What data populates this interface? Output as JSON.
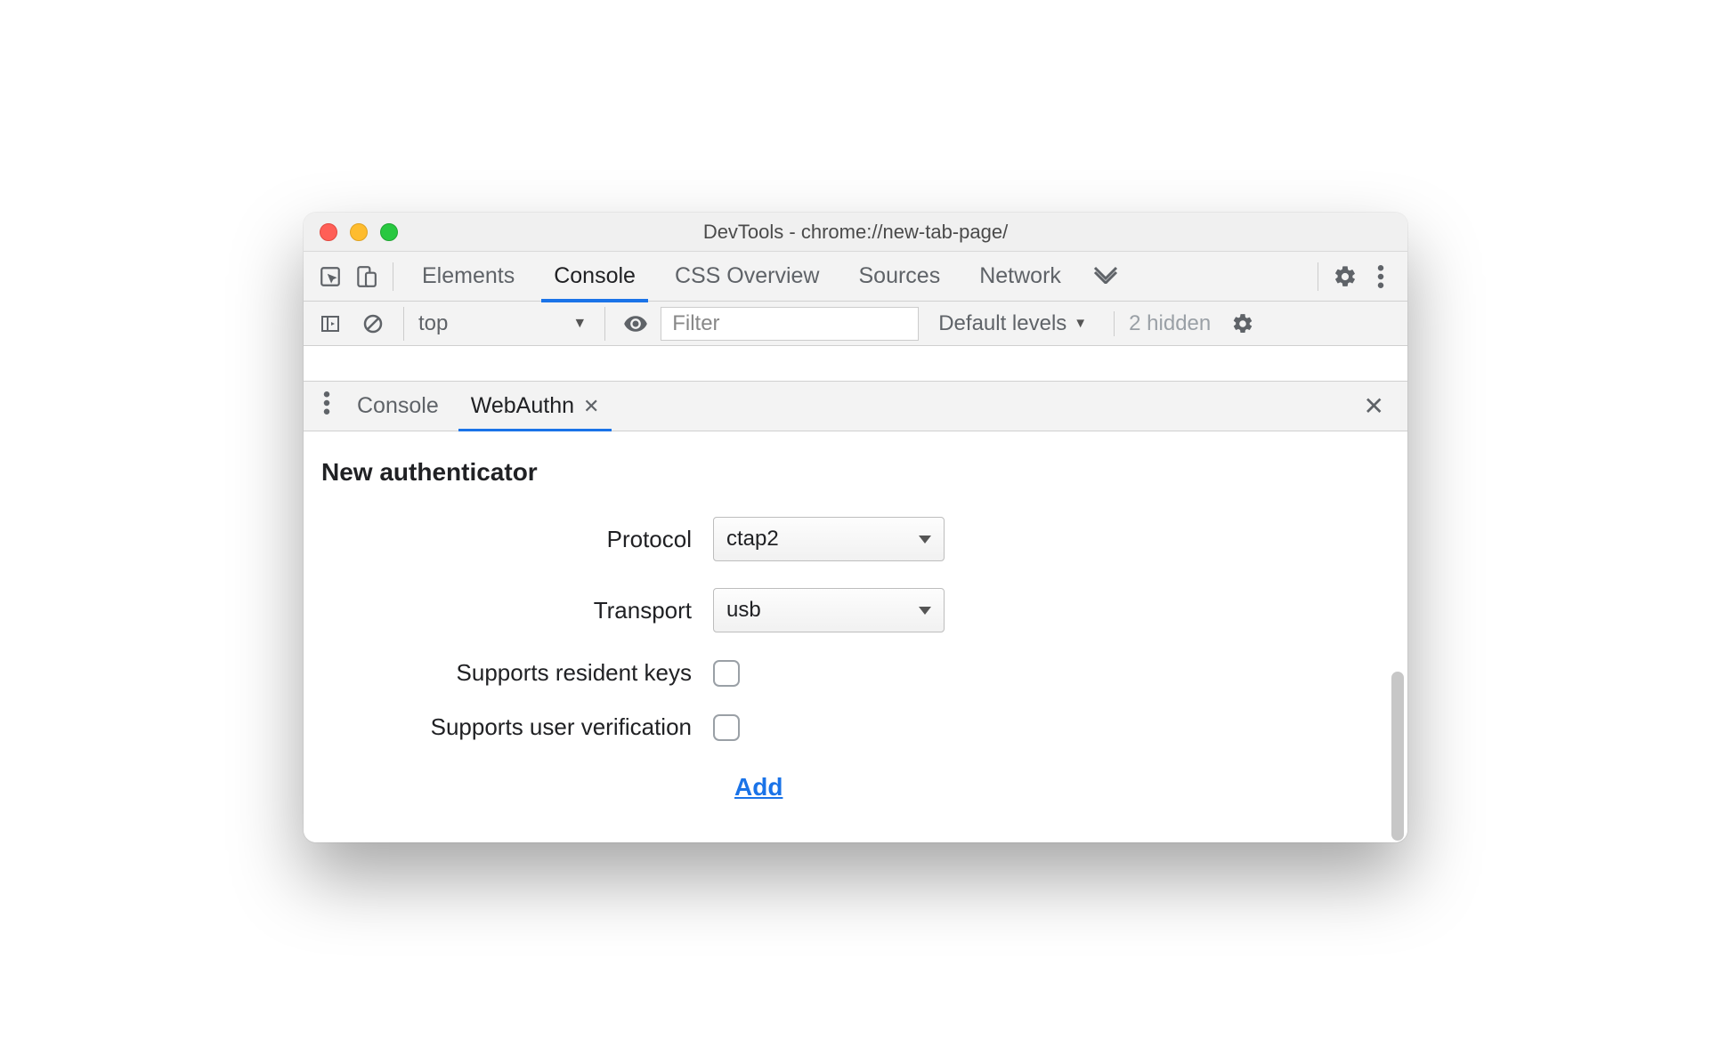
{
  "window": {
    "title": "DevTools - chrome://new-tab-page/"
  },
  "tabs": {
    "elements": "Elements",
    "console": "Console",
    "css_overview": "CSS Overview",
    "sources": "Sources",
    "network": "Network"
  },
  "console_bar": {
    "context": "top",
    "filter_placeholder": "Filter",
    "levels": "Default levels",
    "hidden": "2 hidden"
  },
  "drawer": {
    "console": "Console",
    "webauthn": "WebAuthn"
  },
  "form": {
    "heading": "New authenticator",
    "protocol_label": "Protocol",
    "protocol_value": "ctap2",
    "transport_label": "Transport",
    "transport_value": "usb",
    "resident_label": "Supports resident keys",
    "userverify_label": "Supports user verification",
    "add": "Add"
  }
}
